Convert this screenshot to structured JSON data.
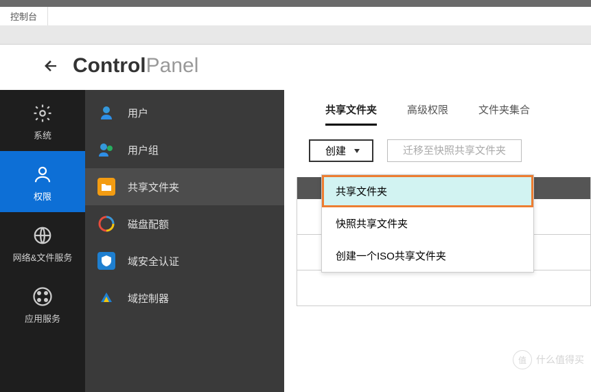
{
  "console_label": "控制台",
  "title": {
    "bold": "Control",
    "thin": "Panel"
  },
  "sidebar_primary": {
    "items": [
      {
        "label": "系统",
        "icon": "gear"
      },
      {
        "label": "权限",
        "icon": "person",
        "active": true
      },
      {
        "label": "网络&文件服务",
        "icon": "globe"
      },
      {
        "label": "应用服务",
        "icon": "grid"
      }
    ]
  },
  "sidebar_secondary": {
    "items": [
      {
        "label": "用户",
        "icon": "user",
        "color": "#2e8fe6"
      },
      {
        "label": "用户组",
        "icon": "users",
        "color": "#2e8fe6"
      },
      {
        "label": "共享文件夹",
        "icon": "folder",
        "color": "#f39c12",
        "active": true
      },
      {
        "label": "磁盘配额",
        "icon": "quota",
        "color": ""
      },
      {
        "label": "域安全认证",
        "icon": "shield",
        "color": "#1e6fc0"
      },
      {
        "label": "域控制器",
        "icon": "domain",
        "color": "#1e6fc0"
      }
    ]
  },
  "tabs": [
    {
      "label": "共享文件夹",
      "active": true
    },
    {
      "label": "高级权限"
    },
    {
      "label": "文件夹集合"
    }
  ],
  "toolbar": {
    "create_label": "创建",
    "migrate_label": "迁移至快照共享文件夹"
  },
  "dropdown": {
    "options": [
      {
        "label": "共享文件夹",
        "highlight": true
      },
      {
        "label": "快照共享文件夹"
      },
      {
        "label": "创建一个ISO共享文件夹"
      }
    ]
  },
  "watermark": {
    "badge": "值",
    "text": "什么值得买"
  }
}
